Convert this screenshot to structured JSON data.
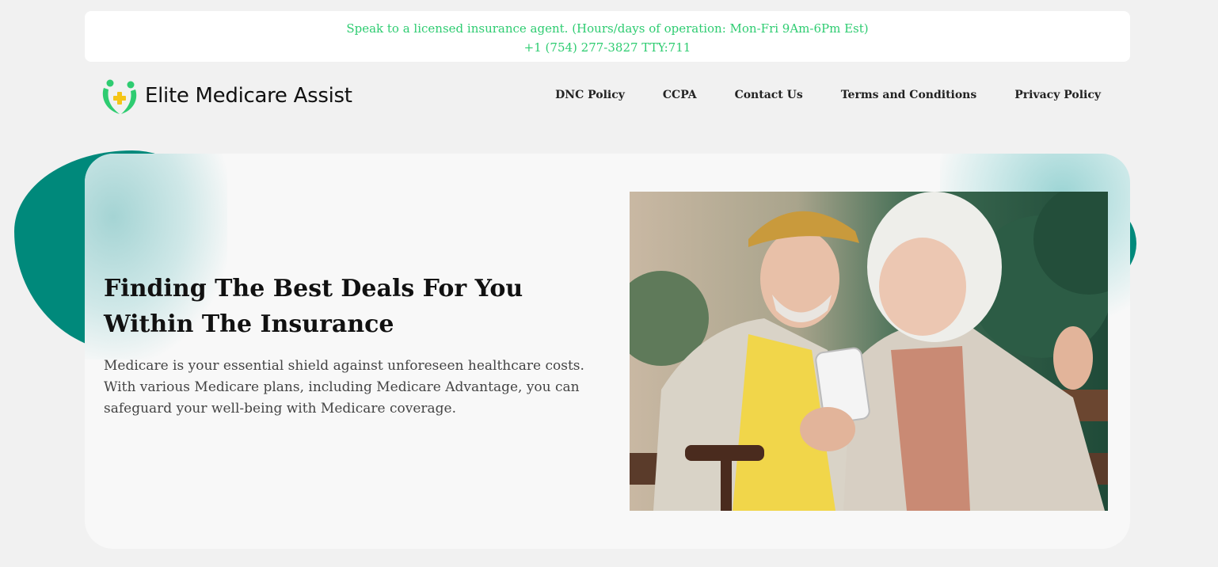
{
  "announcement": {
    "line1": "Speak to a licensed insurance agent. (Hours/days of operation: Mon-Fri 9Am-6Pm Est)",
    "line2": "+1 (754) 277-3827 TTY:711"
  },
  "brand": {
    "name": "Elite Medicare Assist",
    "logo_icon": "people-cross-icon"
  },
  "nav": {
    "items": [
      {
        "label": "DNC Policy"
      },
      {
        "label": "CCPA"
      },
      {
        "label": "Contact Us"
      },
      {
        "label": "Terms and Conditions"
      },
      {
        "label": "Privacy Policy"
      }
    ]
  },
  "hero": {
    "title": "Finding The Best Deals For You Within The Insurance",
    "description": "Medicare is your essential shield against unforeseen healthcare costs. With various Medicare plans, including Medicare Advantage, you can safeguard your well-being with Medicare coverage."
  },
  "colors": {
    "accent_green": "#2ecc71",
    "teal": "#00897b"
  }
}
